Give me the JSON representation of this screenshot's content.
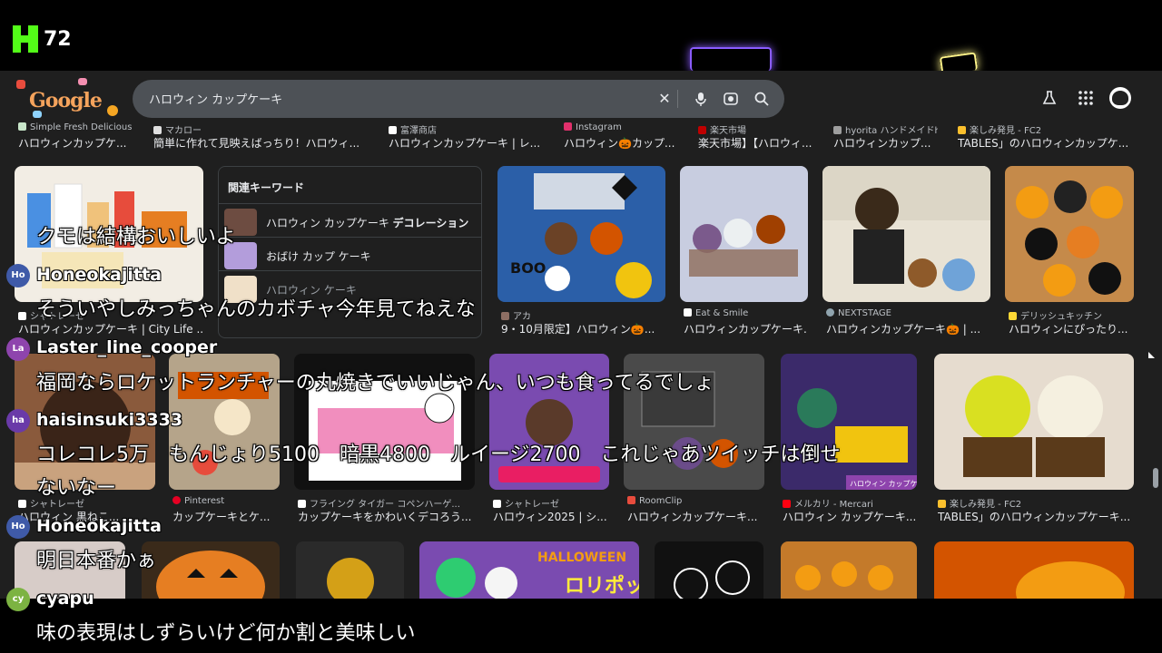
{
  "overlay": {
    "viewer_count": "72"
  },
  "search": {
    "query": "ハロウィン カップケーキ"
  },
  "related": {
    "title": "関連キーワード",
    "items": [
      {
        "prefix": "ハロウィン カップケーキ ",
        "bold": "デコレーション"
      },
      {
        "prefix": "おばけ カップ ケーキ",
        "bold": ""
      },
      {
        "prefix": "ハロウィン ケーキ",
        "bold": ""
      }
    ]
  },
  "row0": [
    {
      "src": "Simple Fresh Delicious",
      "title": "ハロウィンカップケ..."
    },
    {
      "src": "マカロー",
      "title": "簡単に作れて見映えばっちり！ハロウィ..."
    },
    {
      "src": "富澤商店",
      "title": "ハロウィンカップケーキ | レ..."
    },
    {
      "src": "Instagram",
      "title": "ハロウィン🎃カップ..."
    },
    {
      "src": "楽天市場",
      "title": "楽天市場】【ハロウィ..."
    },
    {
      "src": "hyorita ハンドメイドhyorita...",
      "title": "ハロウィンカップ..."
    },
    {
      "src": "楽しみ発見 - FC2",
      "title": "TABLES」のハロウィンカップケ..."
    }
  ],
  "row1": [
    {
      "src": "シャトレーゼ",
      "title": "ハロウィンカップケーキ | City Life ..."
    },
    {
      "src": "アカ",
      "title": "9・10月限定】ハロウィン🎃..."
    },
    {
      "src": "Eat & Smile",
      "title": "ハロウィンカップケーキ..."
    },
    {
      "src": "NEXTSTAGE",
      "title": "ハロウィンカップケーキ🎃 | ..."
    },
    {
      "src": "デリッシュキッチン",
      "title": "ハロウィンにぴったり..."
    }
  ],
  "row2": [
    {
      "src": "シャトレーゼ",
      "title": "ハロウィン 黒ねこ..."
    },
    {
      "src": "Pinterest",
      "title": "カップケーキとケ..."
    },
    {
      "src": "フライング タイガー コペンハーゲ...",
      "title": "カップケーキをかわいくデコろう..."
    },
    {
      "src": "シャトレーゼ",
      "title": "ハロウィン2025 | シ..."
    },
    {
      "src": "RoomClip",
      "title": "ハロウィンカップケーキ..."
    },
    {
      "src": "メルカリ - Mercari",
      "title": "ハロウィン カップケーキ..."
    },
    {
      "src": "楽しみ発見 - FC2",
      "title": "TABLES」のハロウィンカップケーキ..."
    }
  ],
  "thumb_text": {
    "sale_tag": "ハロウィン カップケーキ",
    "lollipop": "ロリポップ",
    "halloween": "HALLOWEEN",
    "boo": "BOO"
  },
  "chat": [
    {
      "user": "",
      "initials": "",
      "message": "クモは結構おいしいよ"
    },
    {
      "user": "Honeokajitta",
      "initials": "Ho",
      "message": "そういやしみっちゃんのカボチャ今年見てねえな"
    },
    {
      "user": "Laster_line_cooper",
      "initials": "La",
      "message": "福岡ならロケットランチャーの丸焼きでいいじゃん、いつも食ってるでしょ"
    },
    {
      "user": "haisinsuki3333",
      "initials": "ha",
      "message": "コレコレ5万　もんじょり5100　暗黒4800　ルイージ2700　これじゃあツイッチは倒せ"
    },
    {
      "user": "",
      "initials": "",
      "message": "ないなー"
    },
    {
      "user": "Honeokajitta",
      "initials": "Ho",
      "message": "明日本番かぁ"
    },
    {
      "user": "cyapu",
      "initials": "cy",
      "message": "味の表現はしずらいけど何か割と美味しい"
    }
  ],
  "colors": {
    "kick_green": "#53fc18",
    "background": "#1f1f1f",
    "searchbox": "#4d5156"
  }
}
